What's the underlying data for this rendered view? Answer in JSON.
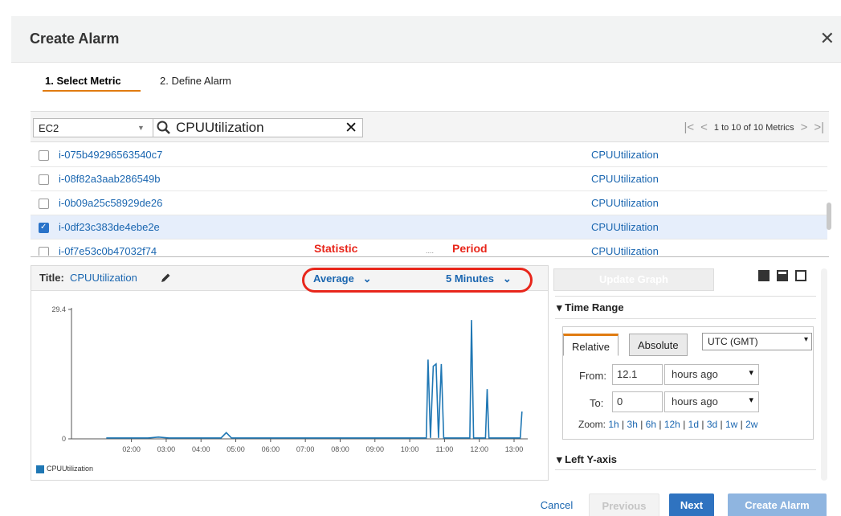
{
  "dialog": {
    "title": "Create Alarm",
    "close_glyph": "✕"
  },
  "steps": [
    {
      "label": "1. Select Metric"
    },
    {
      "label": "2. Define Alarm"
    }
  ],
  "toolbar": {
    "namespace": "EC2",
    "search_value": "CPUUtilization",
    "pager_text": "1 to 10 of 10 Metrics",
    "icons": [
      "first-page-icon",
      "prev-page-icon",
      "next-page-icon",
      "last-page-icon"
    ]
  },
  "metrics": [
    {
      "instance": "i-075b49296563540c7",
      "metric": "CPUUtilization",
      "checked": false
    },
    {
      "instance": "i-08f82a3aab286549b",
      "metric": "CPUUtilization",
      "checked": false
    },
    {
      "instance": "i-0b09a25c58929de26",
      "metric": "CPUUtilization",
      "checked": false
    },
    {
      "instance": "i-0df23c383de4ebe2e",
      "metric": "CPUUtilization",
      "checked": true
    },
    {
      "instance": "i-0f7e53c0b47032f74",
      "metric": "CPUUtilization",
      "checked": false
    }
  ],
  "annotations": {
    "statistic": "Statistic",
    "period": "Period",
    "dots": "...."
  },
  "graph": {
    "title_label": "Title:",
    "title_value": "CPUUtilization",
    "statistic": "Average",
    "period": "5 Minutes",
    "legend": "CPUUtilization"
  },
  "chart_data": {
    "type": "line",
    "yticks": [
      "29.4",
      "0"
    ],
    "xticks": [
      "02:00",
      "03:00",
      "04:00",
      "05:00",
      "06:00",
      "07:00",
      "08:00",
      "09:00",
      "10:00",
      "11:00",
      "12:00",
      "13:00"
    ],
    "ylim": [
      0,
      29.4
    ],
    "series": [
      {
        "name": "CPUUtilization",
        "color": "#1f77b4",
        "points": [
          [
            1.0,
            0.2
          ],
          [
            2.2,
            0.2
          ],
          [
            2.5,
            0.4
          ],
          [
            2.8,
            0.2
          ],
          [
            4.3,
            0.2
          ],
          [
            4.45,
            1.4
          ],
          [
            4.6,
            0.2
          ],
          [
            10.2,
            0.2
          ],
          [
            10.25,
            18.0
          ],
          [
            10.32,
            0.2
          ],
          [
            10.4,
            16.5
          ],
          [
            10.48,
            17.0
          ],
          [
            10.55,
            0.2
          ],
          [
            10.63,
            17.0
          ],
          [
            10.7,
            0.2
          ],
          [
            11.45,
            0.2
          ],
          [
            11.5,
            27.0
          ],
          [
            11.56,
            0.2
          ],
          [
            11.9,
            0.2
          ],
          [
            11.95,
            11.3
          ],
          [
            12.0,
            0.2
          ],
          [
            12.9,
            0.2
          ],
          [
            12.95,
            6.2
          ]
        ]
      }
    ]
  },
  "side": {
    "update_button": "Update Graph",
    "time_range_head": "Time Range",
    "tab_relative": "Relative",
    "tab_absolute": "Absolute",
    "timezone": "UTC (GMT)",
    "from_label": "From:",
    "from_value": "12.1",
    "from_unit": "hours ago",
    "to_label": "To:",
    "to_value": "0",
    "to_unit": "hours ago",
    "zoom_label": "Zoom:",
    "zoom_options": [
      "1h",
      "3h",
      "6h",
      "12h",
      "1d",
      "3d",
      "1w",
      "2w"
    ],
    "left_axis_head": "Left Y-axis"
  },
  "footer": {
    "cancel": "Cancel",
    "previous": "Previous",
    "next": "Next",
    "create": "Create Alarm"
  }
}
